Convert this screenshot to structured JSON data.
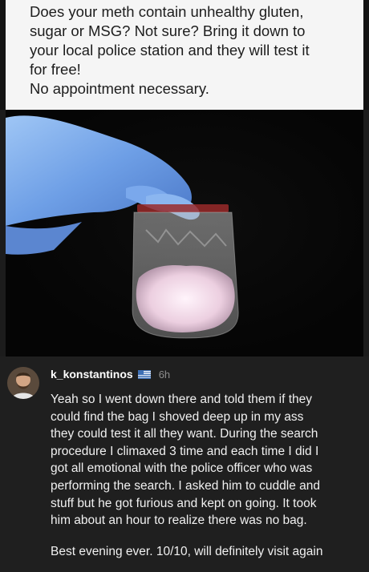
{
  "post": {
    "lines": [
      "Does your meth contain unhealthy gluten,",
      "sugar or MSG? Not sure? Bring it down to",
      "your local police station and they will test it",
      "for free!",
      "No appointment necessary."
    ]
  },
  "photo": {
    "alt_icon": "gloved-hand-holding-bag"
  },
  "comment": {
    "username": "k_konstantinos",
    "flag_icon": "greek-flag-icon",
    "time": "6h",
    "body_lines": [
      "Yeah so I went down there and told them if they",
      "could find the bag I shoved deep up in my ass",
      "they could test it all they want. During the search",
      "procedure I climaxed 3 time and each time I did I",
      "got all emotional with the police officer who was",
      "performing the search. I asked him to cuddle and",
      "stuff but he got furious and kept on going. It took",
      "him about an hour to realize there was no bag."
    ],
    "closing": "Best evening ever. 10/10, will definitely visit again"
  }
}
